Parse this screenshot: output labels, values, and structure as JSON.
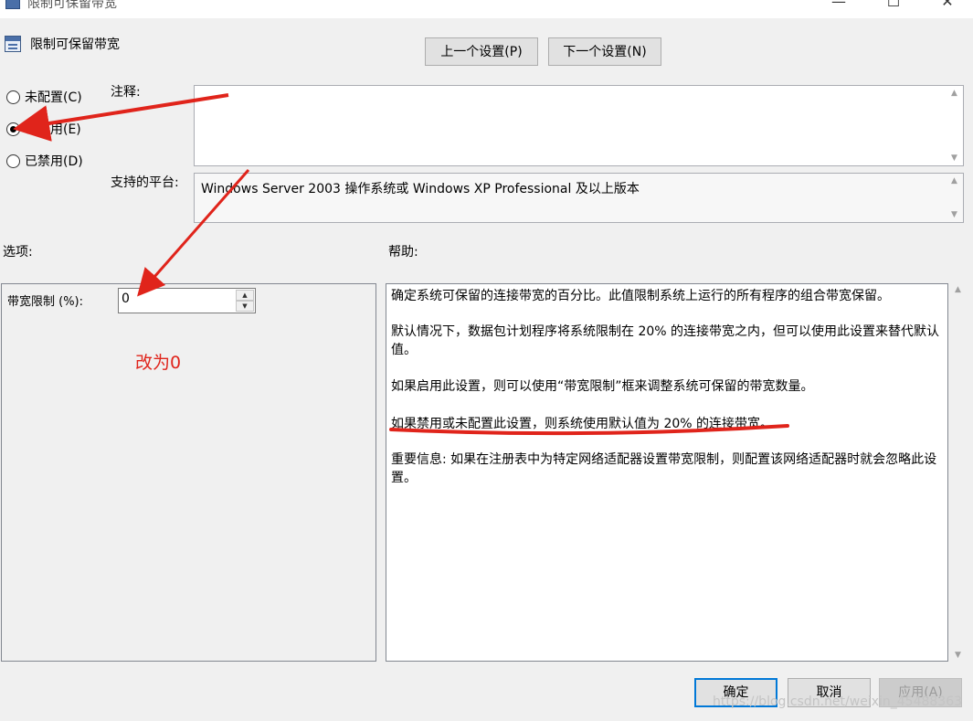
{
  "window": {
    "title": "限制可保留带宽",
    "minimize_glyph": "—",
    "maximize_glyph": "☐",
    "close_glyph": "✕",
    "icon": "group-policy-icon"
  },
  "header": {
    "policy_title": "限制可保留带宽",
    "icon": "policy-setting-icon",
    "prev_label": "上一个设置(P)",
    "next_label": "下一个设置(N)"
  },
  "state": {
    "options": [
      {
        "label": "未配置(C)",
        "checked": false
      },
      {
        "label": "已启用(E)",
        "checked": true
      },
      {
        "label": "已禁用(D)",
        "checked": false
      }
    ]
  },
  "comment": {
    "label": "注释:",
    "value": ""
  },
  "platform": {
    "label": "支持的平台:",
    "value": "Windows Server 2003 操作系统或 Windows XP Professional 及以上版本"
  },
  "options_section": {
    "label": "选项:",
    "bandwidth_label": "带宽限制 (%):",
    "bandwidth_value": "0"
  },
  "help_section": {
    "label": "帮助:",
    "paragraphs": [
      "确定系统可保留的连接带宽的百分比。此值限制系统上运行的所有程序的组合带宽保留。",
      "默认情况下，数据包计划程序将系统限制在 20% 的连接带宽之内，但可以使用此设置来替代默认值。",
      "如果启用此设置，则可以使用“带宽限制”框来调整系统可保留的带宽数量。",
      "如果禁用或未配置此设置，则系统使用默认值为 20% 的连接带宽。",
      "重要信息: 如果在注册表中为特定网络适配器设置带宽限制，则配置该网络适配器时就会忽略此设置。"
    ]
  },
  "footer": {
    "ok_label": "确定",
    "cancel_label": "取消",
    "apply_label": "应用(A)"
  },
  "annotation": {
    "text": "改为0",
    "color": "#e0241b"
  },
  "watermark": "https://blog.csdn.net/weixin_45488363"
}
